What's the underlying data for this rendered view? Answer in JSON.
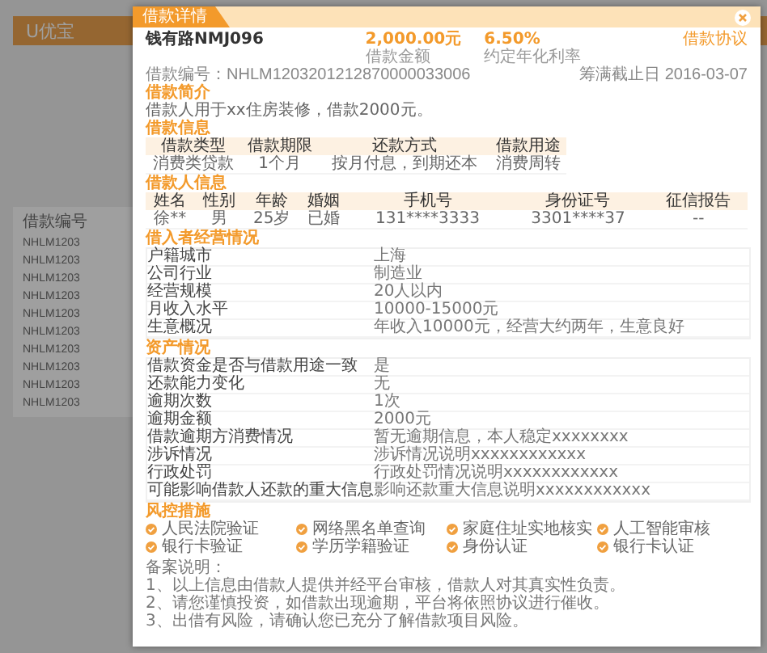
{
  "background": {
    "logo": "U优宝",
    "column_header": "借款编号",
    "loan_numbers": [
      "NHLM1203",
      "NHLM1203",
      "NHLM1203",
      "NHLM1203",
      "NHLM1203",
      "NHLM1203",
      "NHLM1203",
      "NHLM1203",
      "NHLM1203",
      "NHLM1203"
    ]
  },
  "modal": {
    "tab": "借款详情",
    "title": "钱有路NMJ096",
    "agreement_link": "借款协议",
    "loan_number": "借款编号：NHLM1203201212870000033006",
    "deadline": "筹满截止日 2016-03-07",
    "stats": [
      {
        "value": "2,000.00元",
        "label": "借款金额"
      },
      {
        "value": "6.50%",
        "label": "约定年化利率"
      }
    ],
    "sections": [
      {
        "kind": "text",
        "title": "借款简介",
        "text": "借款人用于xx住房装修，借款2000元。"
      },
      {
        "kind": "table",
        "title": "借款信息",
        "columns": [
          "借款类型",
          "借款期限",
          "还款方式",
          "借款用途"
        ],
        "rows": [
          [
            "消费类贷款",
            "1个月",
            "按月付息，到期还本",
            "消费周转"
          ]
        ]
      },
      {
        "kind": "table",
        "title": "借款人信息",
        "columns": [
          "姓名",
          "性别",
          "年龄",
          "婚姻",
          "手机号",
          "身份证号",
          "征信报告"
        ],
        "rows": [
          [
            "徐**",
            "男",
            "25岁",
            "已婚",
            "131****3333",
            "3301****37",
            "--"
          ]
        ]
      },
      {
        "kind": "kv",
        "title": "借入者经营情况",
        "rows": [
          {
            "label": "户籍城市",
            "value": "上海"
          },
          {
            "label": "公司行业",
            "value": "制造业"
          },
          {
            "label": "经营规模",
            "value": "20人以内"
          },
          {
            "label": "月收入水平",
            "value": "10000-15000元"
          },
          {
            "label": "生意概况",
            "value": "年收入10000元，经营大约两年，生意良好"
          }
        ]
      },
      {
        "kind": "kv",
        "title": "资产情况",
        "rows": [
          {
            "label": "借款资金是否与借款用途一致",
            "value": "是"
          },
          {
            "label": "还款能力变化",
            "value": "无"
          },
          {
            "label": "逾期次数",
            "value": "1次"
          },
          {
            "label": "逾期金额",
            "value": "2000元"
          },
          {
            "label": "借款逾期方消费情况",
            "value": "暂无逾期信息，本人稳定xxxxxxxx"
          },
          {
            "label": "涉诉情况",
            "value": "涉诉情况说明xxxxxxxxxxxx"
          },
          {
            "label": "行政处罚",
            "value": "行政处罚情况说明xxxxxxxxxxxx"
          },
          {
            "label": "可能影响借款人还款的重大信息",
            "value": "影响还款重大信息说明xxxxxxxxxxxx"
          }
        ]
      },
      {
        "kind": "measures",
        "title": "风控措施",
        "items": [
          "人民法院验证",
          "网络黑名单查询",
          "家庭住址实地核实",
          "人工智能审核",
          "银行卡验证",
          "学历学籍验证",
          "身份认证",
          "银行卡认证"
        ]
      }
    ],
    "notes": {
      "title": "备案说明：",
      "lines": [
        "1、以上信息由借款人提供并经平台审核，借款人对其真实性负责。",
        "2、请您谨慎投资，如借款出现逾期，平台将依照协议进行催收。",
        "3、出借有风险，请确认您已充分了解借款项目风险。"
      ]
    }
  }
}
